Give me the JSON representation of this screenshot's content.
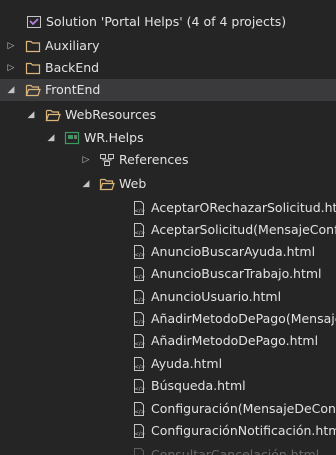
{
  "solution": {
    "label": "Solution 'Portal Helps' (4 of 4 projects)",
    "icon": "solution-icon"
  },
  "folders": {
    "auxiliary": "Auxiliary",
    "backend": "BackEnd",
    "frontend": "FrontEnd",
    "webresources": "WebResources",
    "web": "Web"
  },
  "project": {
    "label": "WR.Helps",
    "icon": "csharp-web-project-icon"
  },
  "references": {
    "label": "References",
    "icon": "references-icon"
  },
  "files": [
    "AceptarORechazarSolicitud.html",
    "AceptarSolicitud(MensajeConfirmacion).html",
    "AnuncioBuscarAyuda.html",
    "AnuncioBuscarTrabajo.html",
    "AnuncioUsuario.html",
    "AñadirMetodoDePago(MensajeConfirmacion).html",
    "AñadirMetodoDePago.html",
    "Ayuda.html",
    "Búsqueda.html",
    "Configuración(MensajeDeConfirmacion).html",
    "ConfiguraciónNotificación.html",
    "ConsultarCancelación.html"
  ],
  "colors": {
    "background": "#252526",
    "selected_row": "#3a3a3c",
    "folder": "#dcb67a",
    "solution_icon": "#b180d7",
    "project_icon": "#3c9a5f",
    "text": "#e2e2e2"
  }
}
